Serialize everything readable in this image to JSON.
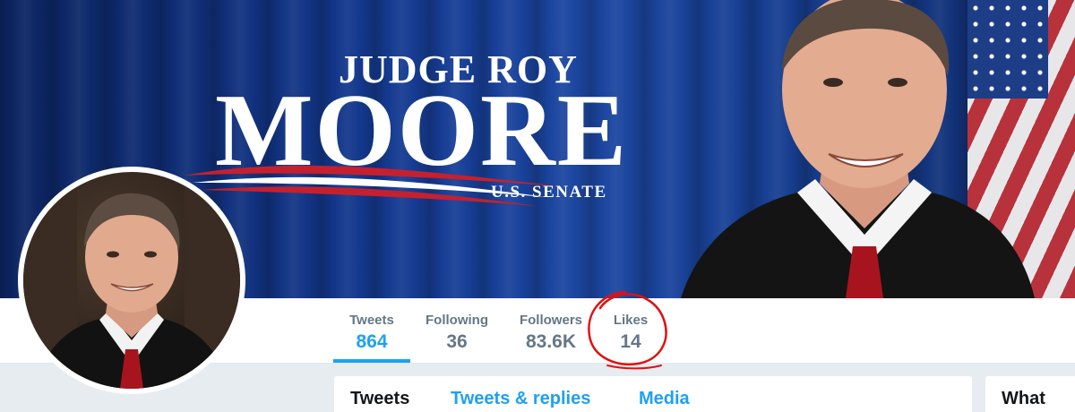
{
  "banner": {
    "title_top": "JUDGE ROY",
    "title_main": "MOORE",
    "subtitle": "U.S. SENATE"
  },
  "profile_nav": {
    "stats": [
      {
        "label": "Tweets",
        "value": "864",
        "active": true
      },
      {
        "label": "Following",
        "value": "36",
        "active": false
      },
      {
        "label": "Followers",
        "value": "83.6K",
        "active": false
      },
      {
        "label": "Likes",
        "value": "14",
        "active": false
      }
    ],
    "highlight_color": "#e01010"
  },
  "timeline_tabs": {
    "tweets": "Tweets",
    "tweets_replies": "Tweets & replies",
    "media": "Media"
  },
  "sidebar": {
    "card_title": "What"
  },
  "colors": {
    "accent": "#1da1f2",
    "banner_blue": "#14398f",
    "page_background": "#e6ecf0"
  }
}
